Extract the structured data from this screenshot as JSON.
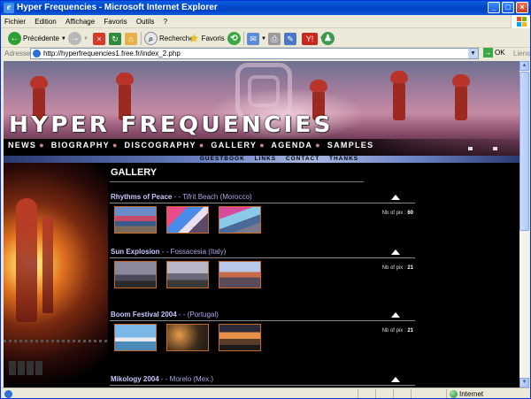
{
  "window": {
    "title": "Hyper Frequencies - Microsoft Internet Explorer"
  },
  "menu": [
    "Fichier",
    "Edition",
    "Affichage",
    "Favoris",
    "Outils",
    "?"
  ],
  "toolbar": {
    "back_label": "Précédente",
    "search_label": "Rechercher",
    "favorites_label": "Favoris"
  },
  "address": {
    "label": "Adresse",
    "url": "http://hyperfrequencies1.free.fr/index_2.php",
    "go_label": "OK",
    "links_label": "Liens"
  },
  "site": {
    "title": "HYPER FREQUENCIES",
    "nav": [
      "NEWS",
      "BIOGRAPHY",
      "DISCOGRAPHY",
      "GALLERY",
      "AGENDA",
      "SAMPLES"
    ],
    "subnav": [
      "GUESTBOOK",
      "LINKS",
      "CONTACT",
      "THANKS"
    ],
    "gallery_title": "GALLERY",
    "pix_label": "Nb of pix :",
    "entries": [
      {
        "name": "Rhythms of Peace",
        "location": " - - Tifrit Beach (Morocco)",
        "count": "60"
      },
      {
        "name": "Sun Explosion",
        "location": " - - Fossacesia (Italy)",
        "count": "21"
      },
      {
        "name": "Boom Festival 2004",
        "location": " - - (Portugal)",
        "count": "21"
      },
      {
        "name": "Mikology 2004",
        "location": " - - Morelo (Mex.)",
        "count": ""
      }
    ]
  },
  "status": {
    "zone": "Internet"
  },
  "colors": {
    "titlebar": "#0048C8",
    "page_bg": "#000000",
    "entry_name": "#C9C8FF",
    "thumb_border": "#C86A28"
  }
}
